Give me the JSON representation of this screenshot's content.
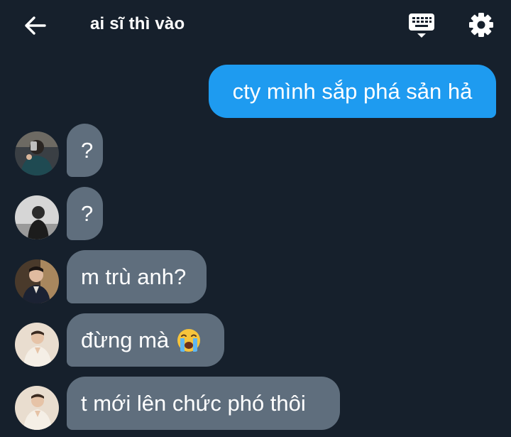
{
  "header": {
    "title": "ai sĩ thì vào",
    "back_icon": "arrow-left-icon",
    "keyboard_icon": "keyboard-icon",
    "settings_icon": "gear-icon"
  },
  "colors": {
    "background": "#16202c",
    "outgoing_bubble": "#1e9bf0",
    "incoming_bubble": "#5f6e7d",
    "text": "#ffffff"
  },
  "messages": [
    {
      "direction": "outgoing",
      "text": "cty mình sắp phá sản hả"
    },
    {
      "direction": "incoming",
      "text": "?"
    },
    {
      "direction": "incoming",
      "text": "?"
    },
    {
      "direction": "incoming",
      "text": "m trù anh?"
    },
    {
      "direction": "incoming",
      "text": "đừng mà",
      "emoji": "crying-face-emoji"
    },
    {
      "direction": "incoming",
      "text": "t mới lên chức phó thôi"
    }
  ]
}
